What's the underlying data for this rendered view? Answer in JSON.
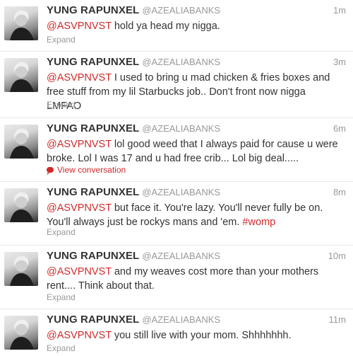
{
  "tweets": [
    {
      "name": "YUNG RAPUNXEL",
      "handle": "@AZEALIABANKS",
      "time": "1m",
      "mention": "@ASVPNVST",
      "body": " hold ya head my nigga.",
      "hashtag": "",
      "action": "Expand"
    },
    {
      "name": "YUNG RAPUNXEL",
      "handle": "@AZEALIABANKS",
      "time": "3m",
      "mention": "@ASVPNVST",
      "body": " I used to bring u mad chicken & fries boxes and free stuff from my lil Starbucks job.. Don't front now nigga LMFAO",
      "hashtag": "",
      "action": "Expand"
    },
    {
      "name": "YUNG RAPUNXEL",
      "handle": "@AZEALIABANKS",
      "time": "6m",
      "mention": "@ASVPNVST",
      "body": " lol good weed that I always paid for cause u were broke. Lol I was 17 and u had free crib... Lol big deal.....",
      "hashtag": "",
      "action": "View conversation"
    },
    {
      "name": "YUNG RAPUNXEL",
      "handle": "@AZEALIABANKS",
      "time": "8m",
      "mention": "@ASVPNVST",
      "body": " but face it. You're lazy. You'll never fully be on. You'll always just be rockys mans and 'em. ",
      "hashtag": "#womp",
      "action": "Expand"
    },
    {
      "name": "YUNG RAPUNXEL",
      "handle": "@AZEALIABANKS",
      "time": "10m",
      "mention": "@ASVPNVST",
      "body": " and my weaves cost more than your mothers rent.... Think about that.",
      "hashtag": "",
      "action": "Expand"
    },
    {
      "name": "YUNG RAPUNXEL",
      "handle": "@AZEALIABANKS",
      "time": "11m",
      "mention": "@ASVPNVST",
      "body": " you still live with your mom. Shhhhhhh.",
      "hashtag": "",
      "action": "Expand"
    }
  ],
  "colors": {
    "accent": "#d02a2a",
    "meta": "#999999",
    "text": "#333333"
  }
}
